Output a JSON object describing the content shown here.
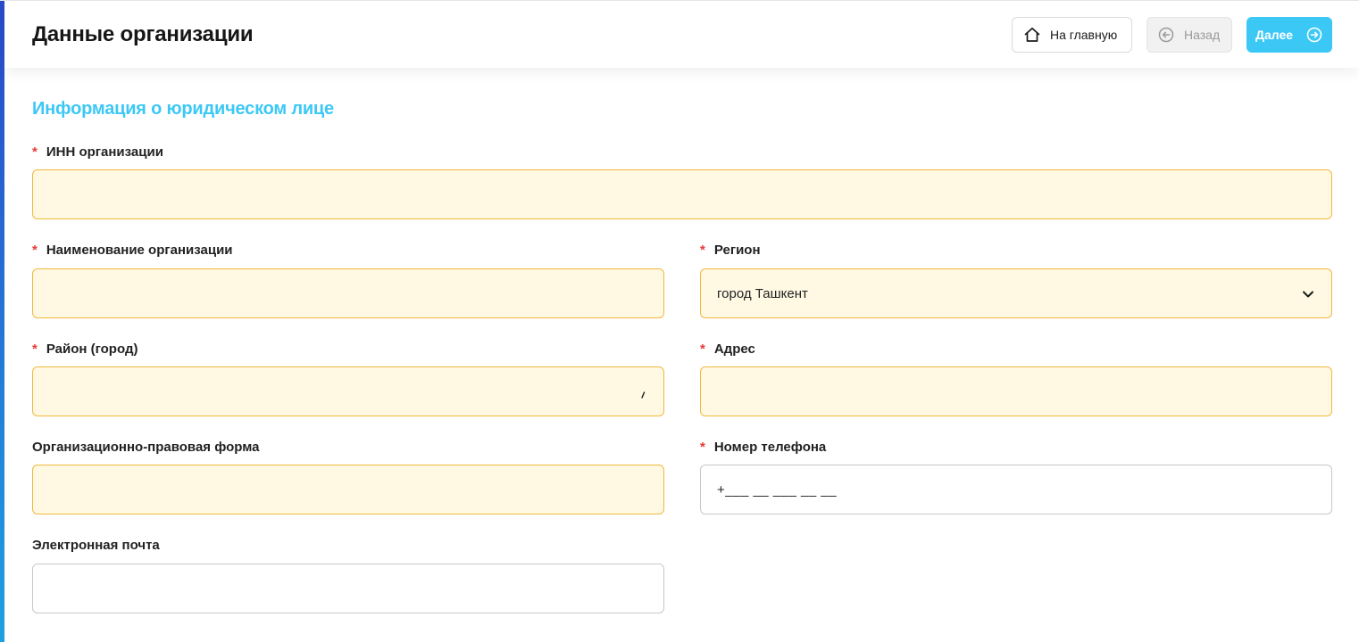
{
  "header": {
    "title": "Данные организации",
    "home_label": "На главную",
    "back_label": "Назад",
    "next_label": "Далее"
  },
  "section": {
    "title": "Информация о юридическом лице"
  },
  "form": {
    "inn": {
      "label": "ИНН организации",
      "value": ""
    },
    "name": {
      "label": "Наименование организации",
      "value": ""
    },
    "region": {
      "label": "Регион",
      "value": "город Ташкент"
    },
    "district": {
      "label": "Район (город)",
      "value": ""
    },
    "address": {
      "label": "Адрес",
      "value": ""
    },
    "legal_form": {
      "label": "Организационно-правовая форма",
      "value": ""
    },
    "phone": {
      "label": "Номер телефона",
      "value": "+___ __ ___ __ __"
    },
    "email": {
      "label": "Электронная почта",
      "value": ""
    }
  },
  "colors": {
    "accent": "#3cc8f5",
    "required_marker": "#e53935",
    "required_field_bg": "#fff8e3",
    "required_field_border": "#f0b93c"
  }
}
